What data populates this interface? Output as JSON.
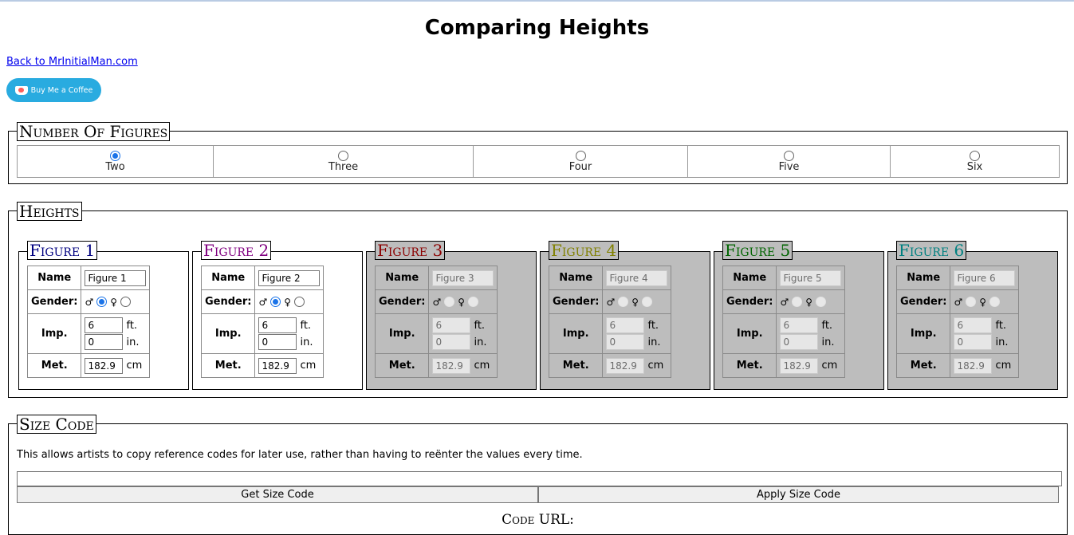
{
  "page": {
    "title": "Comparing Heights",
    "back_link": "Back to MrInitialMan.com",
    "coffee_label": "Buy Me a Coffee"
  },
  "number_of_figures": {
    "legend": "Number Of Figures",
    "options": [
      "Two",
      "Three",
      "Four",
      "Five",
      "Six"
    ],
    "selected": "Two"
  },
  "heights": {
    "legend": "Heights",
    "labels": {
      "name": "Name",
      "gender": "Gender:",
      "imp": "Imp.",
      "met": "Met.",
      "ft": "ft.",
      "in": "in.",
      "cm": "cm",
      "male_symbol": "♂",
      "female_symbol": "♀"
    },
    "figures": [
      {
        "title": "Figure 1",
        "color": "#000080",
        "name": "Figure 1",
        "gender": "male",
        "ft": "6",
        "in": "0",
        "cm": "182.9",
        "enabled": true
      },
      {
        "title": "Figure 2",
        "color": "#800080",
        "name": "Figure 2",
        "gender": "male",
        "ft": "6",
        "in": "0",
        "cm": "182.9",
        "enabled": true
      },
      {
        "title": "Figure 3",
        "color": "#8b0000",
        "name": "Figure 3",
        "gender": "none",
        "ft": "6",
        "in": "0",
        "cm": "182.9",
        "enabled": false
      },
      {
        "title": "Figure 4",
        "color": "#808000",
        "name": "Figure 4",
        "gender": "none",
        "ft": "6",
        "in": "0",
        "cm": "182.9",
        "enabled": false
      },
      {
        "title": "Figure 5",
        "color": "#006400",
        "name": "Figure 5",
        "gender": "none",
        "ft": "6",
        "in": "0",
        "cm": "182.9",
        "enabled": false
      },
      {
        "title": "Figure 6",
        "color": "#008080",
        "name": "Figure 6",
        "gender": "none",
        "ft": "6",
        "in": "0",
        "cm": "182.9",
        "enabled": false
      }
    ]
  },
  "size_code": {
    "legend": "Size Code",
    "description": "This allows artists to copy reference codes for later use, rather than having to reënter the values every time.",
    "value": "",
    "get_label": "Get Size Code",
    "apply_label": "Apply Size Code",
    "code_url_label": "Code URL:"
  }
}
